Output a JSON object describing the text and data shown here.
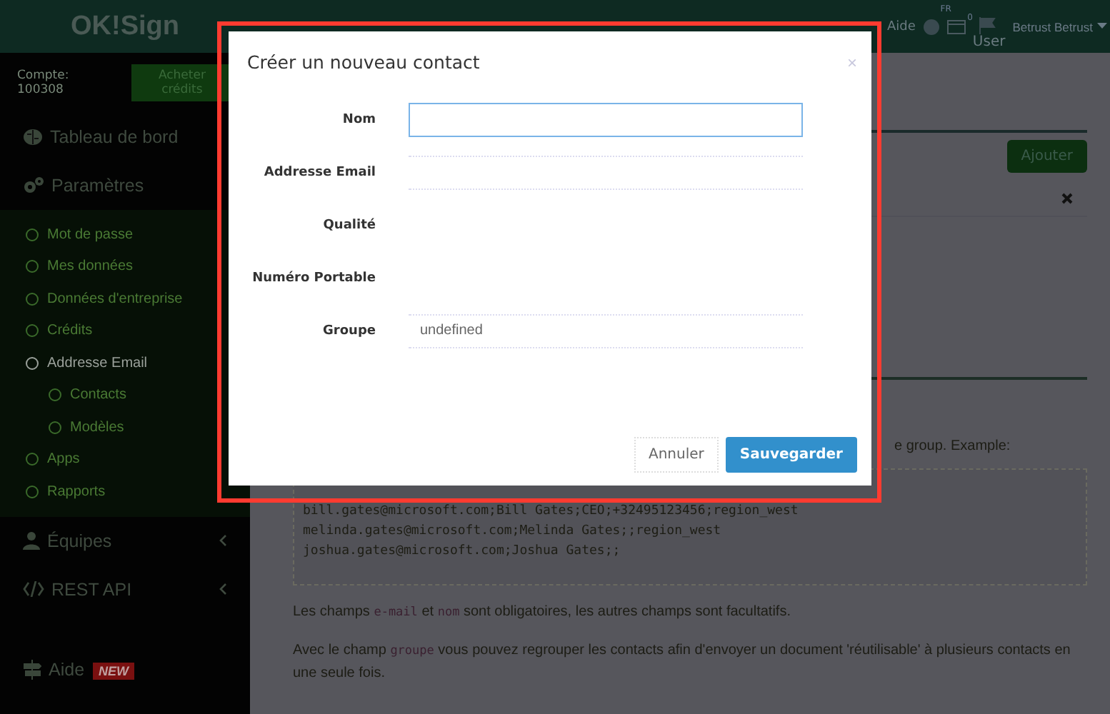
{
  "brand": {
    "logo": "OK!Sign"
  },
  "account": {
    "label": "Compte: 100308",
    "buy_button": "Acheter crédits"
  },
  "sidebar": {
    "items": [
      {
        "label": "Tableau de bord",
        "selected": false
      },
      {
        "label": "Paramètres",
        "selected": false,
        "expanded": true,
        "children": [
          {
            "label": "Mot de passe",
            "selected": false
          },
          {
            "label": "Mes données",
            "selected": false
          },
          {
            "label": "Données d'entreprise",
            "selected": false
          },
          {
            "label": "Crédits",
            "selected": false
          },
          {
            "label": "Addresse Email",
            "selected": true,
            "children": [
              {
                "label": "Contacts",
                "selected": false
              },
              {
                "label": "Modèles",
                "selected": false
              }
            ]
          },
          {
            "label": "Apps",
            "selected": false
          },
          {
            "label": "Rapports",
            "selected": false
          }
        ]
      },
      {
        "label": "Équipes",
        "selected": false,
        "expanded": false
      },
      {
        "label": "REST API",
        "selected": false,
        "expanded": false
      },
      {
        "label": "Aide",
        "selected": false,
        "badge": "NEW"
      }
    ]
  },
  "topbar": {
    "help": "Aide",
    "language": "FR",
    "cart_count": "0",
    "user_caption": "User",
    "user_name": "Betrust Betrust"
  },
  "panel": {
    "add_button": "Ajouter"
  },
  "content": {
    "intro_tail": "e group. Example:",
    "code_lines": [
      "bill.gates@microsoft.com;Bill Gates;CEO;+32495123456;region_west",
      "melinda.gates@microsoft.com;Melinda Gates;;region_west",
      "joshua.gates@microsoft.com;Joshua Gates;;"
    ],
    "paragraphs": [
      [
        {
          "kind": "text",
          "text": "Les champs "
        },
        {
          "kind": "code",
          "text": "e-mail"
        },
        {
          "kind": "text",
          "text": " et "
        },
        {
          "kind": "code",
          "text": "nom"
        },
        {
          "kind": "text",
          "text": " sont obligatoires, les autres champs sont facultatifs."
        }
      ],
      [
        {
          "kind": "text",
          "text": "Avec le champ "
        },
        {
          "kind": "code",
          "text": "groupe"
        },
        {
          "kind": "text",
          "text": " vous pouvez regrouper les contacts afin d'envoyer un document 'réutilisable' à plusieurs contacts en une seule fois."
        }
      ]
    ]
  },
  "modal": {
    "title": "Créer un nouveau contact",
    "close": "×",
    "fields": [
      {
        "label": "Nom",
        "kind": "input",
        "focused": true
      },
      {
        "label": "Addresse Email",
        "kind": "line",
        "focused": false
      },
      {
        "label": "Qualité",
        "kind": "plain",
        "focused": false
      },
      {
        "label": "Numéro Portable",
        "kind": "plain",
        "focused": false
      },
      {
        "label": "Groupe",
        "kind": "line",
        "value": "undefined",
        "focused": false
      }
    ],
    "cancel": "Annuler",
    "save": "Sauvegarder"
  }
}
